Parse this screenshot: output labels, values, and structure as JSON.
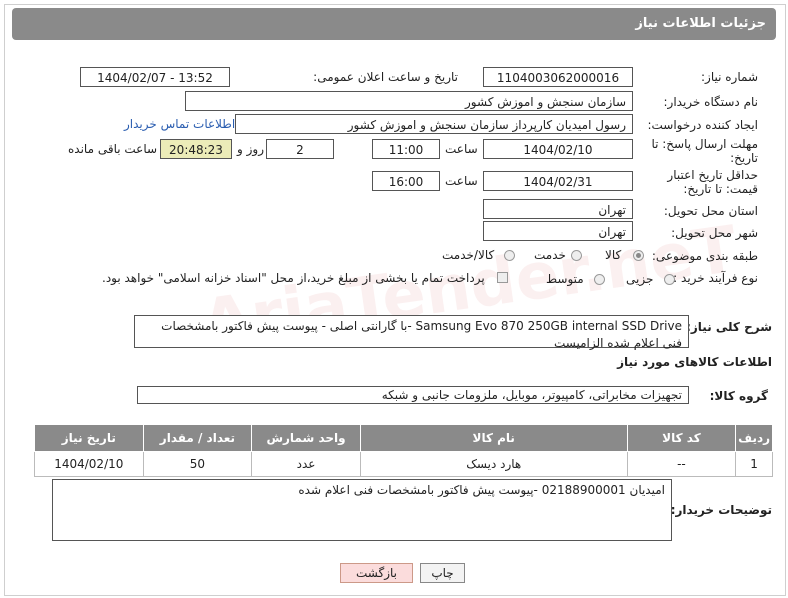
{
  "header": {
    "title": "جزئیات اطلاعات نیاز"
  },
  "fields": {
    "need_number_label": "شماره نیاز:",
    "need_number": "1104003062000016",
    "announce_label": "تاریخ و ساعت اعلان عمومی:",
    "announce_value": "1404/02/07 - 13:52",
    "buyer_org_label": "نام دستگاه خریدار:",
    "buyer_org": "سازمان سنجش و اموزش کشور",
    "creator_label": "ایجاد کننده درخواست:",
    "creator": "رسول امیدیان کارپرداز سازمان سنجش و اموزش کشور",
    "contact_link": "اطلاعات تماس خریدار",
    "deadline_label": "مهلت ارسال پاسخ: تا تاریخ:",
    "deadline_date": "1404/02/10",
    "time_label": "ساعت",
    "deadline_time": "11:00",
    "days_value": "2",
    "days_label": "روز و",
    "remaining_time": "20:48:23",
    "remaining_label": "ساعت باقی مانده",
    "price_validity_label": "حداقل تاریخ اعتبار قیمت: تا تاریخ:",
    "price_date": "1404/02/31",
    "price_time": "16:00",
    "province_label": "استان محل تحویل:",
    "province": "تهران",
    "city_label": "شهر محل تحویل:",
    "city": "تهران",
    "category_label": "طبقه بندی موضوعی:",
    "category_options": [
      "کالا",
      "خدمت",
      "کالا/خدمت"
    ],
    "process_label": "نوع فرآیند خرید :",
    "process_options": [
      "جزیی",
      "متوسط"
    ],
    "payment_note": "پرداخت تمام یا بخشی از مبلغ خرید،از محل \"اسناد خزانه اسلامی\" خواهد بود.",
    "desc_label": "شرح کلی نیاز:",
    "description": "Samsung Evo 870 250GB internal  SSD  Drive -با گارانتی اصلی - پیوست پیش فاکتور بامشخصات فنی اعلام شده الزامیست",
    "goods_info_title": "اطلاعات کالاهای مورد نیاز",
    "group_label": "گروه کالا:",
    "group_value": "تجهیزات مخابراتی، کامپیوتر، موبایل، ملزومات جانبی و شبکه",
    "buyer_notes_label": "توضیحات خریدار:",
    "buyer_notes": "امیدیان 02188900001 -پیوست پیش فاکتور بامشخصات فنی اعلام شده"
  },
  "table": {
    "headers": [
      "ردیف",
      "کد کالا",
      "نام کالا",
      "واحد شمارش",
      "تعداد / مقدار",
      "تاریخ نیاز"
    ],
    "rows": [
      [
        "1",
        "--",
        "هارد دیسک",
        "عدد",
        "50",
        "1404/02/10"
      ]
    ]
  },
  "buttons": {
    "print": "چاپ",
    "back": "بازگشت"
  },
  "watermark": "AriaTender.neT",
  "colors": {
    "header_bg": "#8a8a8a",
    "link": "#2a5db0",
    "back_btn_bg": "#fbdcdc"
  }
}
